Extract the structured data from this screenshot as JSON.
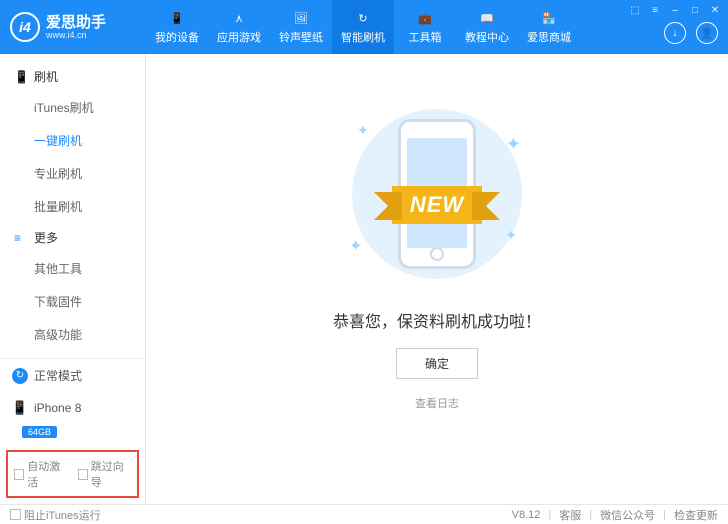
{
  "header": {
    "brand": "爱思助手",
    "brand_sub": "www.i4.cn",
    "logo": "i4",
    "nav": [
      {
        "label": "我的设备",
        "icon": "📱"
      },
      {
        "label": "应用游戏",
        "icon": "⋏"
      },
      {
        "label": "铃声壁纸",
        "icon": "🖼"
      },
      {
        "label": "智能刷机",
        "icon": "↻"
      },
      {
        "label": "工具箱",
        "icon": "💼"
      },
      {
        "label": "教程中心",
        "icon": "📖"
      },
      {
        "label": "爱思商城",
        "icon": "🏪"
      }
    ],
    "active_nav_index": 3
  },
  "sidebar": {
    "groups": [
      {
        "title": "刷机",
        "icon": "📱",
        "items": [
          "iTunes刷机",
          "一键刷机",
          "专业刷机",
          "批量刷机"
        ],
        "active_index": 1
      },
      {
        "title": "更多",
        "icon": "≡",
        "items": [
          "其他工具",
          "下载固件",
          "高级功能"
        ],
        "active_index": -1
      }
    ],
    "mode": {
      "label": "正常模式",
      "icon": "↻"
    },
    "device": {
      "name": "iPhone 8",
      "storage": "64GB"
    },
    "activate": {
      "auto_activate": "自动激活",
      "skip_guide": "跳过向导"
    }
  },
  "main": {
    "ribbon": "NEW",
    "success_text": "恭喜您，保资料刷机成功啦！",
    "ok_button": "确定",
    "view_log": "查看日志"
  },
  "footer": {
    "block_itunes": "阻止iTunes运行",
    "version": "V8.12",
    "support": "客服",
    "wechat": "微信公众号",
    "update": "检查更新"
  }
}
